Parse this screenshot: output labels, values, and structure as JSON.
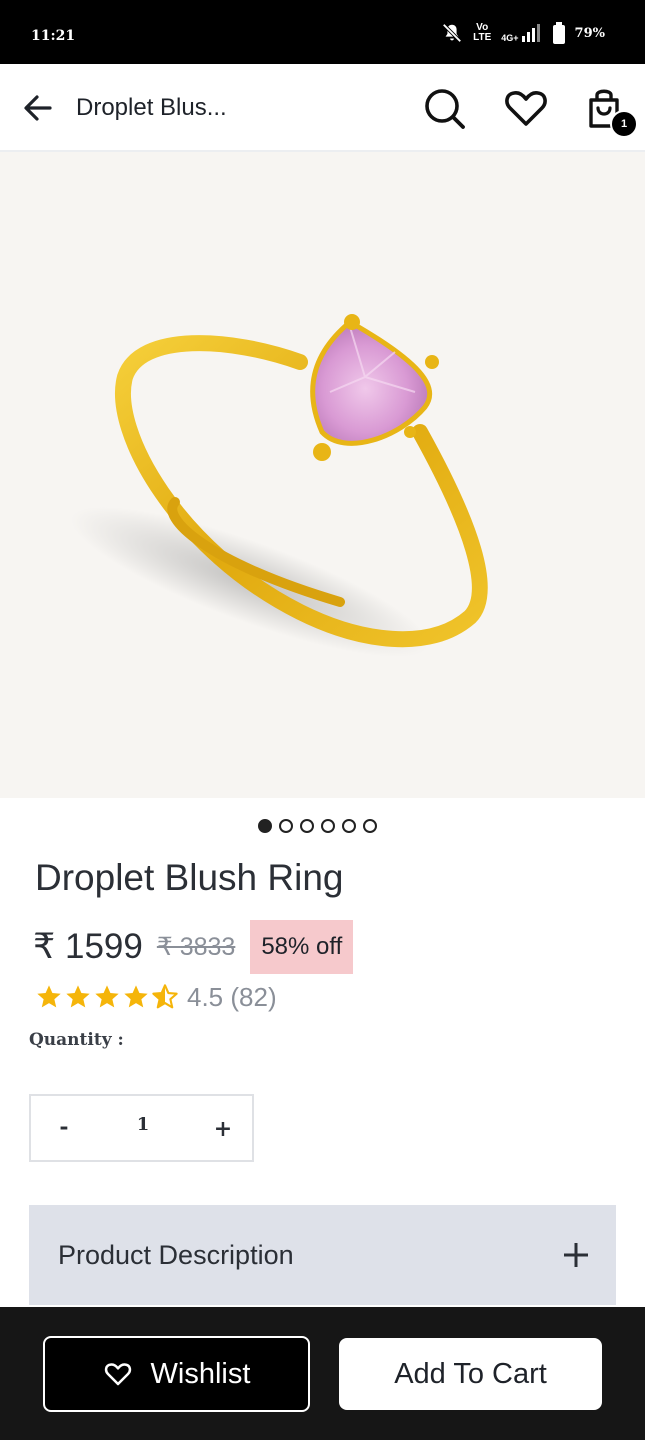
{
  "status_bar": {
    "time": "11:21",
    "network_top": "Vo",
    "network_bottom": "LTE",
    "signal": "4G+",
    "battery": "79%"
  },
  "header": {
    "title": "Droplet Blus...",
    "cart_count": "1",
    "icons": [
      "back-arrow-icon",
      "search-icon",
      "heart-icon",
      "cart-icon"
    ]
  },
  "gallery": {
    "total_images": 6,
    "active_index": 0,
    "colors": {
      "background": "#f7f5f2",
      "gold": "#e8b516",
      "gem": "#e3a7dc"
    }
  },
  "product": {
    "name": "Droplet Blush Ring",
    "price": "₹ 1599",
    "mrp": "₹ 3833",
    "discount": "58% off",
    "rating_value": 4.5,
    "rating_text": "4.5 (82)",
    "discount_color": "#f6c9cc"
  },
  "quantity": {
    "label": "Quantity :",
    "minus": "-",
    "value": "1",
    "plus": "+"
  },
  "accordion": {
    "title": "Product Description"
  },
  "bottom_bar": {
    "wishlist_label": "Wishlist",
    "cart_label": "Add To Cart"
  }
}
